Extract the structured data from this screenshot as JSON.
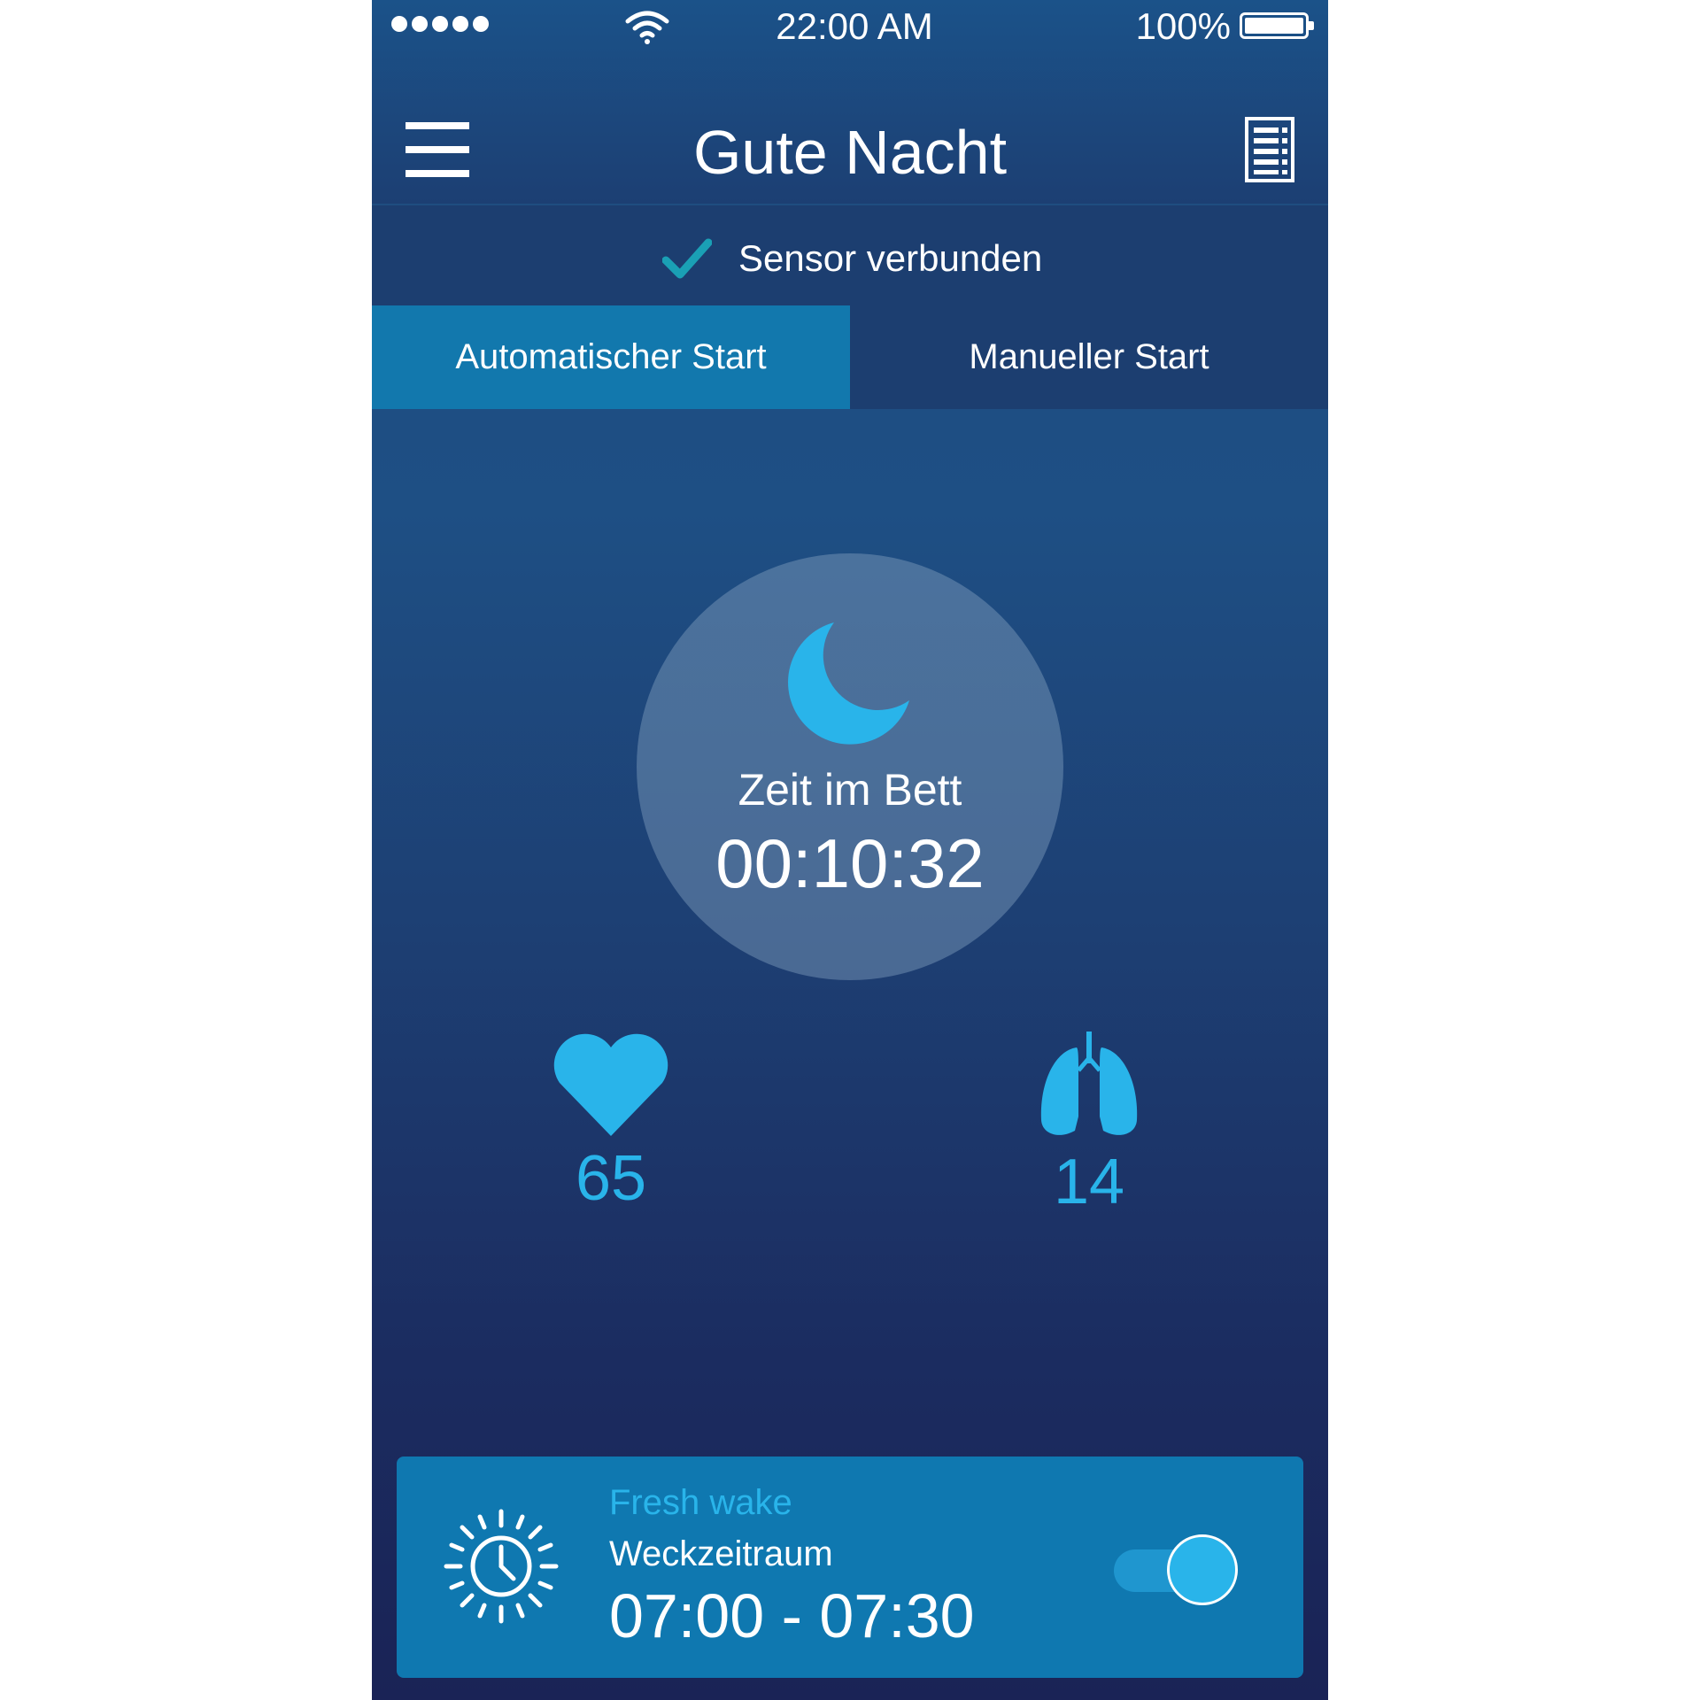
{
  "status_bar": {
    "time": "22:00 AM",
    "battery_percent": "100%",
    "signal_bars": 5
  },
  "header": {
    "title": "Gute Nacht",
    "menu_icon": "hamburger-icon",
    "list_icon": "list-icon"
  },
  "sensor": {
    "label": "Sensor verbunden",
    "icon": "check-icon"
  },
  "tabs": [
    {
      "label": "Automatischer Start",
      "active": true
    },
    {
      "label": "Manueller Start",
      "active": false
    }
  ],
  "sleep": {
    "icon": "moon-icon",
    "label": "Zeit im Bett",
    "duration": "00:10:32"
  },
  "vitals": {
    "heart_rate": {
      "icon": "heart-icon",
      "value": "65"
    },
    "breathing_rate": {
      "icon": "lungs-icon",
      "value": "14"
    }
  },
  "wake": {
    "icon": "sun-clock-icon",
    "subtitle": "Fresh wake",
    "label": "Weckzeitraum",
    "time_range": "07:00 - 07:30",
    "enabled": true
  },
  "colors": {
    "accent": "#29b4ea",
    "active_tab": "#1278ad",
    "card": "#0f78b0",
    "check": "#1aa0b5"
  }
}
